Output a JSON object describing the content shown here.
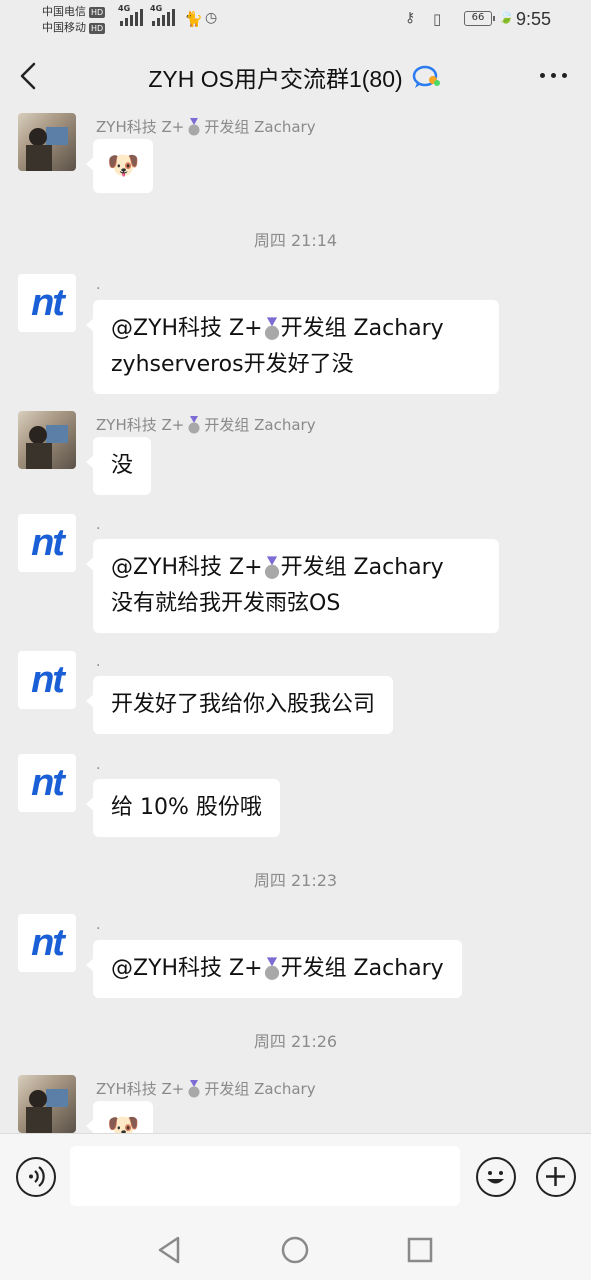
{
  "status_bar": {
    "carrier_1": "中国电信",
    "carrier_2": "中国移动",
    "hd_badge": "HD",
    "network_1": "4G",
    "network_2": "4G",
    "battery": "66",
    "time": "9:55"
  },
  "header": {
    "title": "ZYH OS用户交流群1(80)"
  },
  "messages": [
    {
      "sender": "ZYH科技 Z+",
      "sender_suffix": "开发组 Zachary",
      "content": "🐶"
    },
    {
      "timestamp": "周四 21:14"
    },
    {
      "sender": ".",
      "line1_prefix": "@ZYH科技 Z+",
      "line1_suffix": "开发组 Zachary",
      "line2": "zyhserveros开发好了没"
    },
    {
      "sender": "ZYH科技 Z+",
      "sender_suffix": "开发组 Zachary",
      "content": "没"
    },
    {
      "sender": ".",
      "line1_prefix": "@ZYH科技 Z+",
      "line1_suffix": "开发组 Zachary",
      "line2": "没有就给我开发雨弦OS"
    },
    {
      "sender": ".",
      "content": "开发好了我给你入股我公司"
    },
    {
      "sender": ".",
      "content": "给 10% 股份哦"
    },
    {
      "timestamp": "周四 21:23"
    },
    {
      "sender": ".",
      "line1_prefix": "@ZYH科技 Z+",
      "line1_suffix": "开发组 Zachary"
    },
    {
      "timestamp": "周四 21:26"
    },
    {
      "sender": "ZYH科技 Z+",
      "sender_suffix": "开发组 Zachary",
      "content": "🐶"
    }
  ],
  "avatar_text": "nt",
  "colors": {
    "background": "#ededed",
    "bubble": "#ffffff",
    "nt_blue": "#1a5fd6"
  }
}
